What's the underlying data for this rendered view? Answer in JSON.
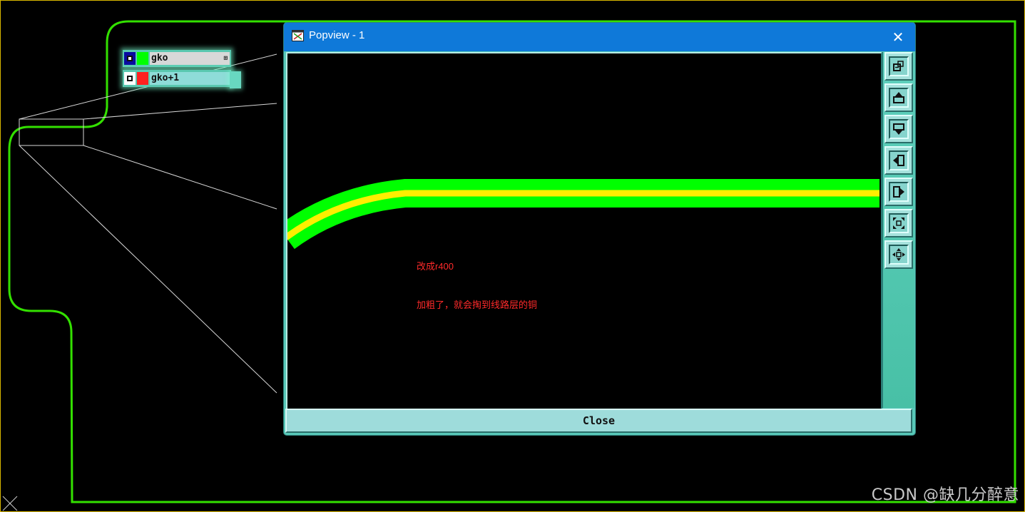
{
  "layers": [
    {
      "name": "gko",
      "swatch": "#00ff00",
      "checkbox": "#0a0aa0",
      "row_color": "#d8d8d8",
      "badge": "⊞"
    },
    {
      "name": "gko+1",
      "swatch": "#ff2020",
      "checkbox": "#ffffff",
      "row_color": "#8edcd8",
      "badge": ""
    }
  ],
  "popview": {
    "title": "Popview - 1",
    "close_icon": "close-icon",
    "footer_label": "Close",
    "annotation_line1": "改成r400",
    "annotation_line2": "加粗了，就会掏到线路层的铜",
    "toolbar_icons": [
      "zoom-fit-icon",
      "pan-up-icon",
      "pan-down-icon",
      "pan-left-icon",
      "pan-right-icon",
      "zoom-in-icon",
      "zoom-out-icon"
    ]
  },
  "watermark": "CSDN @缺几分醉意",
  "colors": {
    "outline": "#33e000",
    "trace": "#00ff00",
    "trace_center": "#ffee00",
    "titlebar": "#0f79d9",
    "annotation": "#ff2a2a"
  }
}
